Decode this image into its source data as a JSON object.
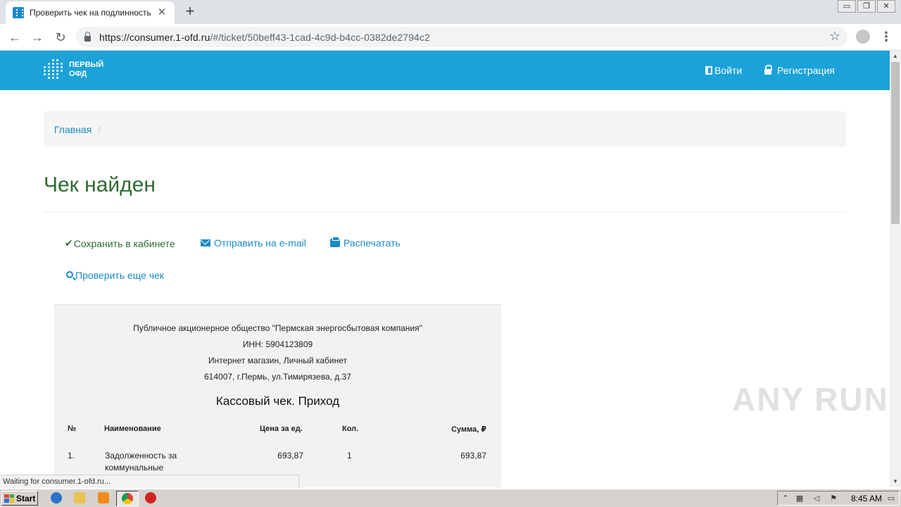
{
  "browser": {
    "tab_title": "Проверить чек на подлинность он",
    "tab_close": "✕",
    "new_tab": "+",
    "url_host": "https://consumer.1-ofd.ru",
    "url_path": "/#/ticket/50beff43-1cad-4c9d-b4cc-0382de2794c2",
    "back": "←",
    "forward": "→",
    "reload": "↻",
    "bookmark_star": "☆",
    "menu": "⋮",
    "window_buttons": [
      "▭",
      "❐",
      "✕"
    ]
  },
  "site": {
    "logo_line1": "ПЕРВЫЙ",
    "logo_line2": "ОФД",
    "login": "Войти",
    "register": "Регистрация",
    "header_color": "#1ba2d8"
  },
  "breadcrumb": {
    "home": "Главная",
    "separator": "/"
  },
  "page": {
    "title": "Чек найден",
    "actions": {
      "save": "Сохранить в кабинете",
      "email": "Отправить на e-mail",
      "print": "Распечатать",
      "check_again": "Проверить еще чек"
    }
  },
  "receipt": {
    "company": "Публичное акционерное общество \"Пермская энергосбытовая компания\"",
    "inn": "ИНН: 5904123809",
    "shop": "Интернет магазин, Личный кабинет",
    "address": "614007, г.Пермь, ул.Тимирязева, д.37",
    "heading": "Кассовый чек. Приход",
    "columns": [
      "№",
      "Наименование",
      "Цена за ед.",
      "Кол.",
      "Сумма, ₽"
    ],
    "rows": [
      {
        "num": "1.",
        "name": "Задолженность за коммунальные",
        "price": "693,87",
        "qty": "1",
        "sum": "693,87"
      }
    ]
  },
  "status_text": "Waiting for consumer.1-ofd.ru...",
  "watermark": "ANY RUN",
  "taskbar": {
    "start": "Start",
    "clock": "8:45 AM"
  },
  "scrollbar": {
    "up": "▲",
    "down": "▼"
  }
}
